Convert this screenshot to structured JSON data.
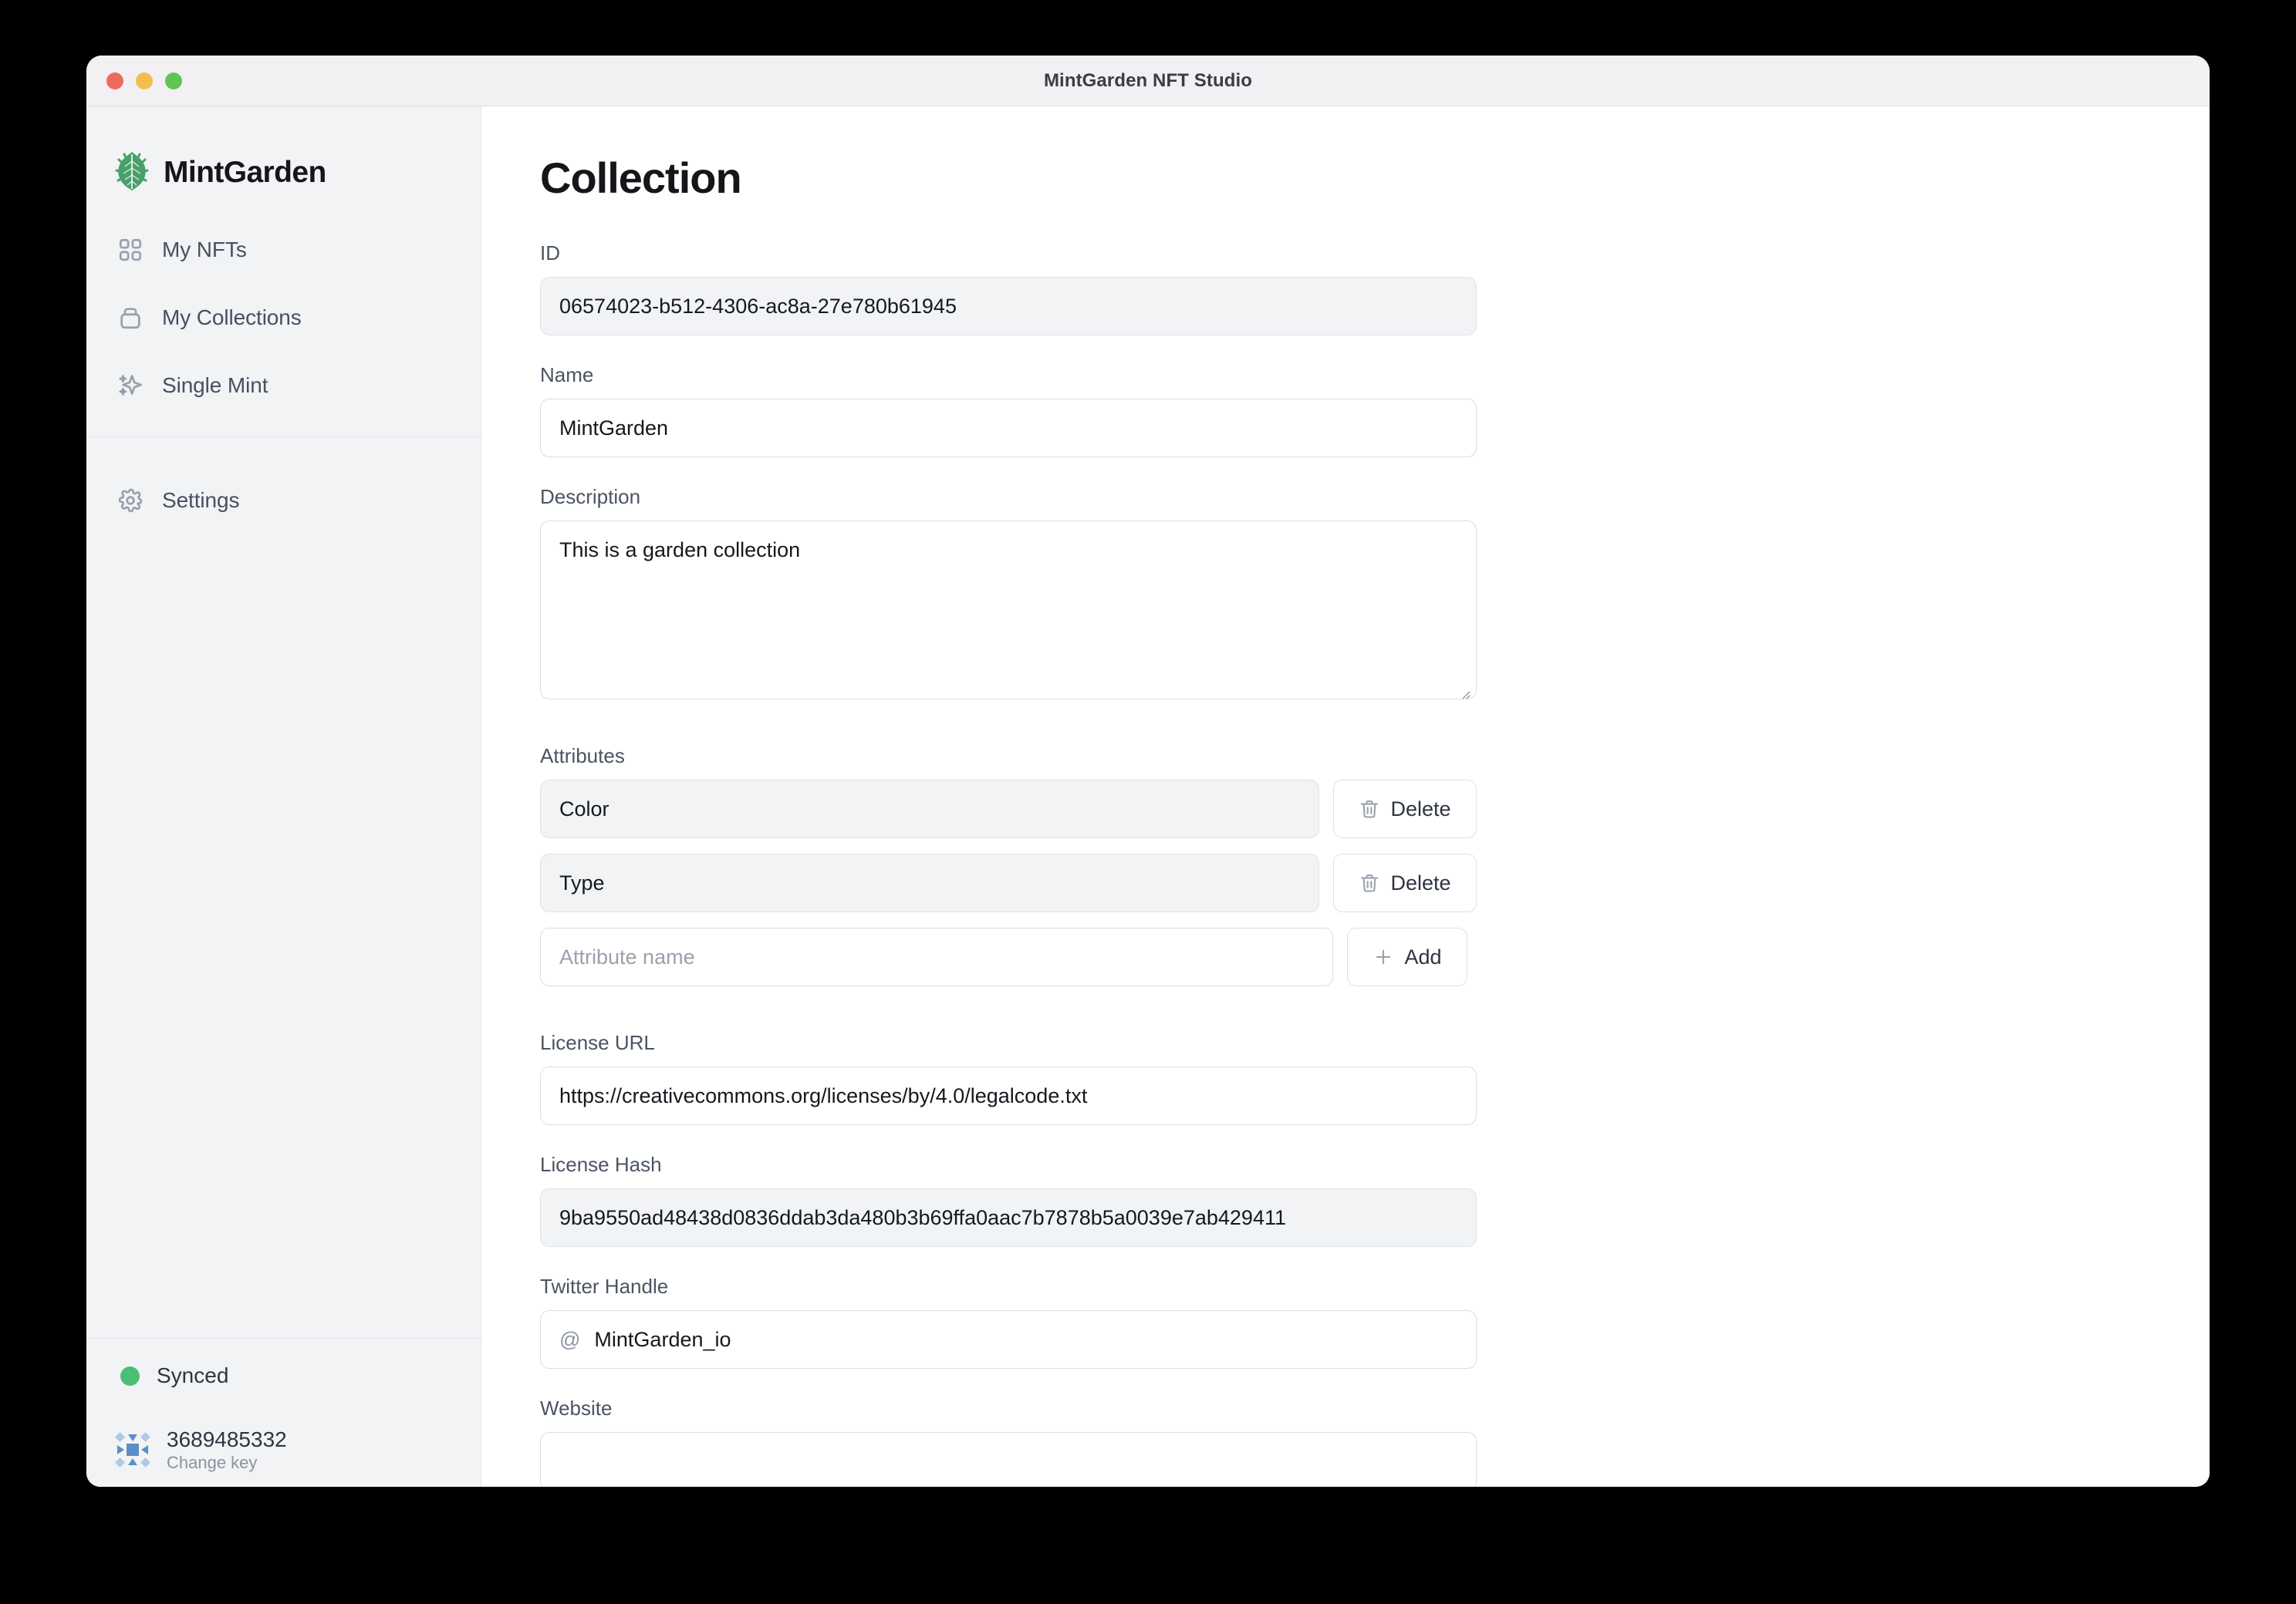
{
  "window": {
    "title": "MintGarden NFT Studio",
    "traffic_lights": [
      "close",
      "minimize",
      "maximize"
    ],
    "colors": {
      "close": "#EC6B5F",
      "minimize": "#F3BE4F",
      "maximize": "#61C555"
    }
  },
  "sidebar": {
    "brand": {
      "name": "MintGarden",
      "logo_icon": "mint-leaf-icon",
      "logo_color": "#49A06B"
    },
    "items": [
      {
        "label": "My NFTs",
        "icon": "grid-icon"
      },
      {
        "label": "My Collections",
        "icon": "collection-box-icon"
      },
      {
        "label": "Single Mint",
        "icon": "sparkles-icon"
      }
    ],
    "bottom_items": [
      {
        "label": "Settings",
        "icon": "gear-icon"
      }
    ],
    "footer": {
      "sync_status": "Synced",
      "sync_color": "#4BBE75",
      "key_id": "3689485332",
      "change_key_label": "Change key",
      "avatar_icon": "identicon-avatar"
    }
  },
  "main": {
    "page_title": "Collection",
    "fields": {
      "id": {
        "label": "ID",
        "value": "06574023-b512-4306-ac8a-27e780b61945",
        "disabled": true
      },
      "name": {
        "label": "Name",
        "value": "MintGarden",
        "disabled": false
      },
      "description": {
        "label": "Description",
        "value": "This is a garden collection",
        "disabled": false
      },
      "attributes": {
        "label": "Attributes",
        "rows": [
          {
            "value": "Color",
            "button": "Delete",
            "button_icon": "trash-icon"
          },
          {
            "value": "Type",
            "button": "Delete",
            "button_icon": "trash-icon"
          }
        ],
        "new_row": {
          "placeholder": "Attribute name",
          "value": "",
          "button": "Add",
          "button_icon": "plus-icon"
        }
      },
      "license_url": {
        "label": "License URL",
        "value": "https://creativecommons.org/licenses/by/4.0/legalcode.txt",
        "disabled": false
      },
      "license_hash": {
        "label": "License Hash",
        "value": "9ba9550ad48438d0836ddab3da480b3b69ffa0aac7b7878b5a0039e7ab429411",
        "disabled": true
      },
      "twitter_handle": {
        "label": "Twitter Handle",
        "prefix": "@",
        "value": "MintGarden_io",
        "disabled": false
      },
      "website": {
        "label": "Website",
        "value": "",
        "disabled": false
      }
    }
  }
}
